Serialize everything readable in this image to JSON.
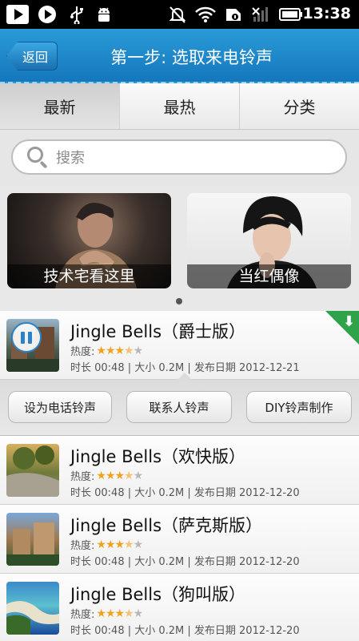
{
  "status_bar": {
    "time": "13:38"
  },
  "header": {
    "back_label": "返回",
    "title": "第一步: 选取来电铃声"
  },
  "tabs": [
    {
      "label": "最新",
      "active": true
    },
    {
      "label": "最热",
      "active": false
    },
    {
      "label": "分类",
      "active": false
    }
  ],
  "search": {
    "placeholder": "搜索"
  },
  "banners": [
    {
      "caption": "技术宅看这里"
    },
    {
      "caption": "当红偶像"
    }
  ],
  "ringtones": [
    {
      "title": "Jingle Bells（爵士版）",
      "heat_label": "热度:",
      "rating": 3.5,
      "meta": "时长 00:48 | 大小 0.2M | 发布日期 2012-12-21",
      "playing": true
    },
    {
      "title": "Jingle Bells（欢快版）",
      "heat_label": "热度:",
      "rating": 3.5,
      "meta": "时长 00:48 | 大小 0.2M | 发布日期 2012-12-20",
      "playing": false
    },
    {
      "title": "Jingle Bells（萨克斯版）",
      "heat_label": "热度:",
      "rating": 3.5,
      "meta": "时长 00:48 | 大小 0.2M | 发布日期 2012-12-20",
      "playing": false
    },
    {
      "title": "Jingle Bells（狗叫版）",
      "heat_label": "热度:",
      "rating": 3.5,
      "meta": "时长 00:48 | 大小 0.2M | 发布日期 2012-12-20",
      "playing": false
    }
  ],
  "actions": {
    "set_ringtone": "设为电话铃声",
    "contact_ringtone": "联系人铃声",
    "diy": "DIY铃声制作"
  },
  "colors": {
    "accent": "#1f8ad0",
    "star": "#f0a21e",
    "download": "#2ea34a"
  }
}
